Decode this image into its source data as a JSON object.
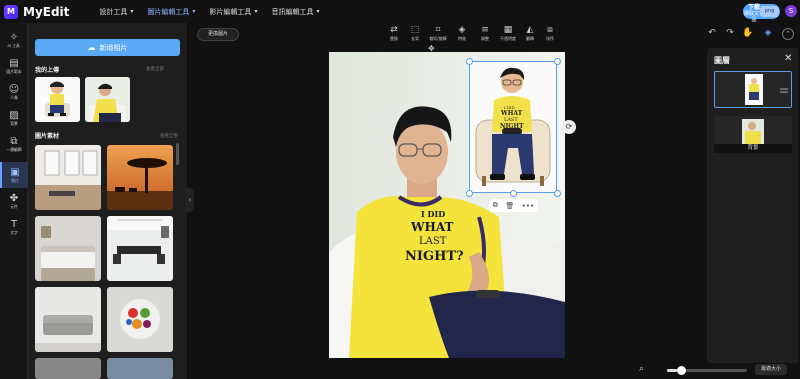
{
  "app": {
    "name": "MyEdit",
    "logo_letter": "M"
  },
  "topnav": {
    "items": [
      {
        "label": "設計工具",
        "active": false
      },
      {
        "label": "圖片編輯工具",
        "active": true
      },
      {
        "label": "影片編輯工具",
        "active": false
      },
      {
        "label": "音訊編輯工具",
        "active": false
      }
    ],
    "download": {
      "label": "下載",
      "sub": "擷取文字品"
    },
    "format": "png",
    "avatar_letter": "S"
  },
  "rail": [
    {
      "label": "AI 工具",
      "icon": "magic-wand-icon",
      "glyph": "✨"
    },
    {
      "label": "圖片範本",
      "icon": "template-icon",
      "glyph": "▤"
    },
    {
      "label": "人像",
      "icon": "portrait-icon",
      "glyph": "☺"
    },
    {
      "label": "背景",
      "icon": "background-icon",
      "glyph": "▨"
    },
    {
      "label": "一鍵編輯",
      "icon": "one-click-edit-icon",
      "glyph": "⧉"
    },
    {
      "label": "照片",
      "icon": "photo-icon",
      "glyph": "▣",
      "active": true
    },
    {
      "label": "元件",
      "icon": "elements-icon",
      "glyph": "✤"
    },
    {
      "label": "文字",
      "icon": "text-icon",
      "glyph": "T"
    }
  ],
  "panel": {
    "new_button": "新增相片",
    "my_uploads": "我的上傳",
    "see_all_1": "查看全部",
    "materials": "圖片素材",
    "see_all_2": "查看全部"
  },
  "toolbar": {
    "replace": "更換圖片",
    "tools": [
      {
        "label": "替換",
        "icon": "replace-icon",
        "glyph": "⇄"
      },
      {
        "label": "去背",
        "icon": "remove-bg-icon",
        "glyph": "⬚"
      },
      {
        "label": "裁切/旋轉",
        "icon": "crop-icon",
        "glyph": "⌗"
      },
      {
        "label": "特效",
        "icon": "effects-icon",
        "glyph": "◈"
      },
      {
        "label": "調整",
        "icon": "adjust-icon",
        "glyph": "≡"
      },
      {
        "label": "不透明度",
        "icon": "opacity-icon",
        "glyph": "▦"
      },
      {
        "label": "翻轉",
        "icon": "flip-icon",
        "glyph": "◭"
      },
      {
        "label": "排序",
        "icon": "arrange-icon",
        "glyph": "⧈"
      }
    ]
  },
  "canvas": {
    "shirt_text": [
      "I DID",
      "WHAT",
      "LAST",
      "NIGHT?"
    ],
    "sticker_text": [
      "I DID",
      "WHAT",
      "LAST",
      "NIGHT"
    ]
  },
  "layers": {
    "title": "圖層",
    "items": [
      {
        "label": "",
        "selected": true
      },
      {
        "label": "背景",
        "selected": false
      }
    ]
  },
  "bottom": {
    "fit_label": "最適大小",
    "zoom_fraction": 0.12
  },
  "colors": {
    "accent": "#5aa9f5",
    "shirt": "#f5e43a",
    "bg": "#111111"
  }
}
